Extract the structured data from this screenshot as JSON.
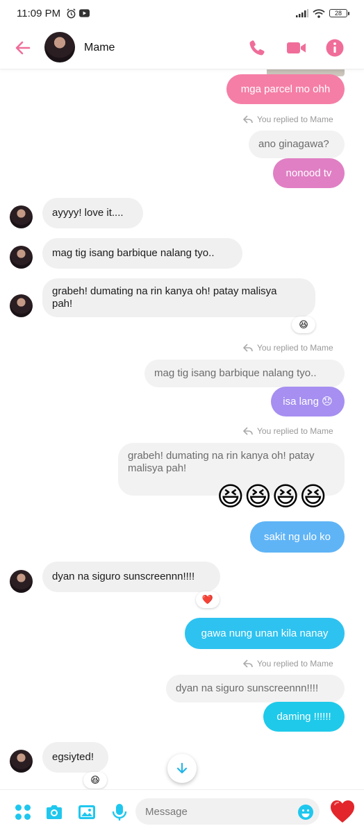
{
  "status_bar": {
    "time": "11:09 PM",
    "battery": "28"
  },
  "header": {
    "contact_name": "Mame"
  },
  "colors": {
    "accent": "#f06d9a",
    "cyan": "#1fc7ee"
  },
  "messages": {
    "m1": "mga parcel mo ohh",
    "reply1_label": "You replied to Mame",
    "q1": "ano ginagawa?",
    "m2": "nonood tv",
    "m3": "ayyyy! love it....",
    "m4": "mag tig isang barbique nalang tyo..",
    "m5_line1": "grabeh! dumating na rin kanya oh! patay malisya",
    "m5_line2": "pah!",
    "m5_reaction": "😆",
    "reply2_label": "You replied to Mame",
    "q2": "mag tig isang barbique nalang tyo..",
    "m6": "isa lang 😞",
    "reply3_label": "You replied to Mame",
    "q3_line1": "grabeh! dumating na rin kanya oh! patay",
    "q3_line2": "malisya pah!",
    "m7": "😆😆😆😆",
    "m8": "sakit ng ulo ko",
    "m9": "dyan na siguro sunscreennn!!!!",
    "m9_reaction": "❤️",
    "m10": "gawa nung unan kila nanay",
    "reply4_label": "You replied to Mame",
    "q4": "dyan na siguro sunscreennn!!!!",
    "m11": "daming !!!!!!",
    "m12": "egsiyted!",
    "m12_reaction": "😆"
  },
  "composer": {
    "placeholder": "Message"
  },
  "icons": {
    "back": "back-arrow-icon",
    "call": "phone-icon",
    "video": "video-camera-icon",
    "info": "info-icon",
    "apps": "grid-dots-icon",
    "camera": "camera-icon",
    "gallery": "image-icon",
    "mic": "microphone-icon",
    "emoji": "emoji-icon",
    "like": "heart-icon",
    "scroll": "arrow-down-icon"
  }
}
